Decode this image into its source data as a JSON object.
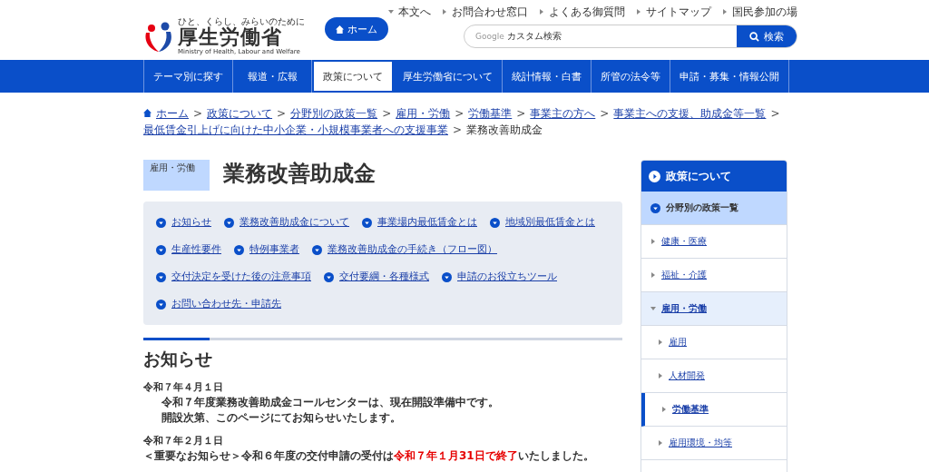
{
  "header": {
    "logo_tagline": "ひと、くらし、みらいのために",
    "logo_name": "厚生労働省",
    "logo_english": "Ministry of Health, Labour and Welfare",
    "home_button": "ホーム",
    "utility_links": [
      {
        "label": "本文へ",
        "kind": "down"
      },
      {
        "label": "お問合わせ窓口",
        "kind": "right"
      },
      {
        "label": "よくある御質問",
        "kind": "right"
      },
      {
        "label": "サイトマップ",
        "kind": "right"
      },
      {
        "label": "国民参加の場",
        "kind": "right"
      }
    ],
    "search": {
      "brand": "Google",
      "placeholder": "カスタム検索",
      "button": "検索"
    }
  },
  "nav": [
    {
      "label": "テーマ別に探す",
      "selected": false
    },
    {
      "label": "報道・広報",
      "selected": false
    },
    {
      "label": "政策について",
      "selected": true
    },
    {
      "label": "厚生労働省について",
      "selected": false
    },
    {
      "label": "統計情報・白書",
      "selected": false
    },
    {
      "label": "所管の法令等",
      "selected": false
    },
    {
      "label": "申請・募集・情報公開",
      "selected": false
    }
  ],
  "breadcrumb": {
    "separator": ">",
    "links": [
      "ホーム",
      "政策について",
      "分野別の政策一覧",
      "雇用・労働",
      "労働基準",
      "事業主の方へ",
      "事業主への支援、助成金等一覧",
      "最低賃金引上げに向けた中小企業・小規模事業者への支援事業"
    ],
    "current": "業務改善助成金"
  },
  "page": {
    "category": "雇用・労働",
    "title": "業務改善助成金"
  },
  "anchor_links": [
    [
      "お知らせ",
      "業務改善助成金について",
      "事業場内最低賃金とは",
      "地域別最低賃金とは"
    ],
    [
      "生産性要件",
      "特例事業者",
      "業務改善助成金の手続き（フロー図）"
    ],
    [
      "交付決定を受けた後の注意事項",
      "交付要綱・各種様式",
      "申請のお役立ちツール"
    ],
    [
      "お問い合わせ先・申請先"
    ]
  ],
  "news": {
    "heading": "お知らせ",
    "items": [
      {
        "date": "令和７年４月１日",
        "indent": true,
        "lines": [
          [
            {
              "text": "令和７年度業務改善助成金コールセンターは、現在開設準備中です。",
              "highlight": false
            }
          ],
          [
            {
              "text": "開設次第、このページにてお知らせいたします。",
              "highlight": false
            }
          ]
        ]
      },
      {
        "date": "令和７年２月１日",
        "indent": false,
        "lines": [
          [
            {
              "text": "＜重要なお知らせ＞令和６年度の交付申請の受付は",
              "highlight": false
            },
            {
              "text": "令和７年１月31日で終了",
              "highlight": true
            },
            {
              "text": "いたしました。",
              "highlight": false
            }
          ]
        ]
      }
    ]
  },
  "sidebar": {
    "title": "政策について",
    "items": [
      {
        "label": "分野別の政策一覧",
        "kind": "section"
      },
      {
        "label": "健康・医療",
        "kind": "category",
        "expanded": false
      },
      {
        "label": "福祉・介護",
        "kind": "category",
        "expanded": false
      },
      {
        "label": "雇用・労働",
        "kind": "category",
        "expanded": true,
        "children": [
          {
            "label": "雇用",
            "selected": false
          },
          {
            "label": "人材開発",
            "selected": false
          },
          {
            "label": "労働基準",
            "selected": true
          },
          {
            "label": "雇用環境・均等",
            "selected": false
          }
        ]
      }
    ]
  }
}
